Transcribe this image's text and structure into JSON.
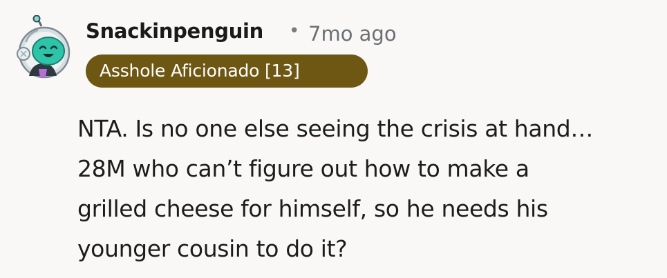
{
  "comment": {
    "author": "Snackinpenguin",
    "separator": "•",
    "timestamp": "7mo ago",
    "flair": "Asshole Aficionado [13]",
    "lines": [
      "NTA. Is no one else seeing the crisis at hand…",
      "28M who can’t figure out how to make a",
      "grilled cheese for himself, so he needs his",
      "younger cousin to do it?"
    ],
    "avatar_icon": "snoo-astronaut-avatar-icon"
  },
  "colors": {
    "background": "#f9f8f7",
    "flair_background": "#6e5713",
    "flair_text": "#ffffff",
    "meta_text": "#6b6f72"
  }
}
